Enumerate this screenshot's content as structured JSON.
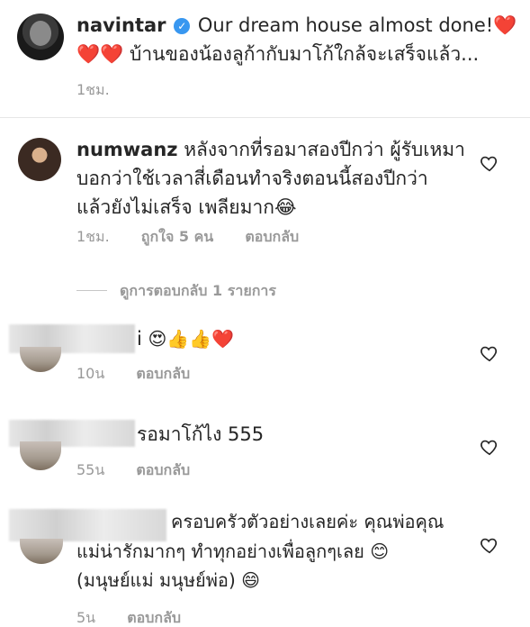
{
  "post": {
    "username": "navintar",
    "caption_en": "Our dream house almost done!",
    "caption_th": "บ้านของน้องลูก้ากับมาโก้ใกล้จะเสร็จแล้ว...",
    "heart_emoji": "❤️",
    "time": "1ชม."
  },
  "comments": [
    {
      "username": "numwanz",
      "text_line1": "หลังจากที่รอมาสองปีกว่า ผู้รับเหมา",
      "text_line2": "บอกว่าใช้เวลาสี่เดือนทำจริงตอนนี้สองปีกว่า",
      "text_line3": "แล้วยังไม่เสร็จ เพลียมาก😂",
      "time": "1ชม.",
      "likes": "ถูกใจ 5 คน",
      "reply_label": "ตอบกลับ",
      "view_replies": "ดูการตอบกลับ 1 รายการ"
    },
    {
      "username_visible": "i",
      "text": "😍👍👍❤️",
      "time": "10น",
      "reply_label": "ตอบกลับ"
    },
    {
      "text": "รอมาโก้ไง 555",
      "time": "55น",
      "reply_label": "ตอบกลับ"
    },
    {
      "text_line1": "ครอบครัวตัวอย่างเลยค่ะ คุณพ่อคุณ",
      "text_line2": "แม่น่ารักมากๆ ทำทุกอย่างเพื่อลูกๆเลย 😊",
      "text_line3": "(มนุษย์แม่ มนุษย์พ่อ) 😄",
      "time": "5น",
      "reply_label": "ตอบกลับ"
    }
  ],
  "icons": {
    "verified": "verified-badge-icon",
    "like": "heart-outline-icon"
  }
}
